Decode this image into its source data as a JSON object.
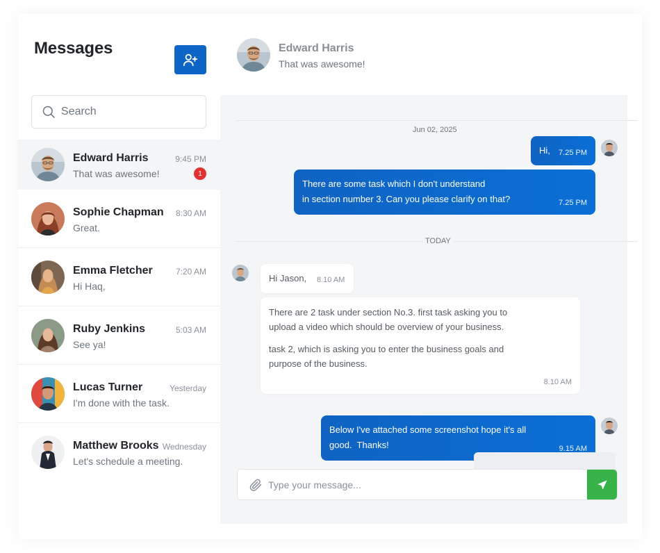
{
  "sidebar": {
    "title": "Messages",
    "new_chat_icon": "user-plus-icon",
    "search": {
      "placeholder": "Search",
      "value": ""
    },
    "conversations": [
      {
        "name": "Edward Harris",
        "time": "9:45 PM",
        "preview": "That was awesome!",
        "unread": "1"
      },
      {
        "name": "Sophie Chapman",
        "time": "8:30 AM",
        "preview": "Great."
      },
      {
        "name": "Emma Fletcher",
        "time": "7:20 AM",
        "preview": "Hi Haq,"
      },
      {
        "name": "Ruby Jenkins",
        "time": "5:03 AM",
        "preview": "See ya!"
      },
      {
        "name": "Lucas Turner",
        "time": "Yesterday",
        "preview": "I'm done with the task."
      },
      {
        "name": "Matthew Brooks",
        "time": "Wednesday",
        "preview": "Let's schedule a meeting."
      }
    ]
  },
  "chat": {
    "header": {
      "name": "Edward Harris",
      "status": "That was awesome!"
    },
    "date_separator_1": "Jun 02, 2025",
    "date_separator_2": "TODAY",
    "messages": [
      {
        "direction": "out",
        "lines": [
          "Hi,"
        ],
        "time": "7.25 PM"
      },
      {
        "direction": "out",
        "lines": [
          "There are some task which I don't understand",
          "in section number 3. Can you please clarify on that?"
        ],
        "time": "7.25 PM"
      },
      {
        "direction": "in",
        "lines": [
          "Hi Jason,"
        ],
        "time": "8.10 AM"
      },
      {
        "direction": "in",
        "paragraphs": [
          "There are 2 task under section No.3. first task asking you to upload a video which should be overview of your business.",
          "task 2, which is asking you to enter the business goals and purpose of the business."
        ],
        "time": "8.10 AM"
      },
      {
        "direction": "out",
        "lines": [
          "Below I've attached some screenshot hope it's all",
          "good.  Thanks!"
        ],
        "time": "9.15 AM"
      }
    ],
    "composer": {
      "placeholder": "Type your message...",
      "value": ""
    }
  },
  "colors": {
    "primary": "#0d65c5",
    "send": "#37b34a",
    "badge": "#e03131",
    "chat_bg": "#f4f5f7"
  }
}
